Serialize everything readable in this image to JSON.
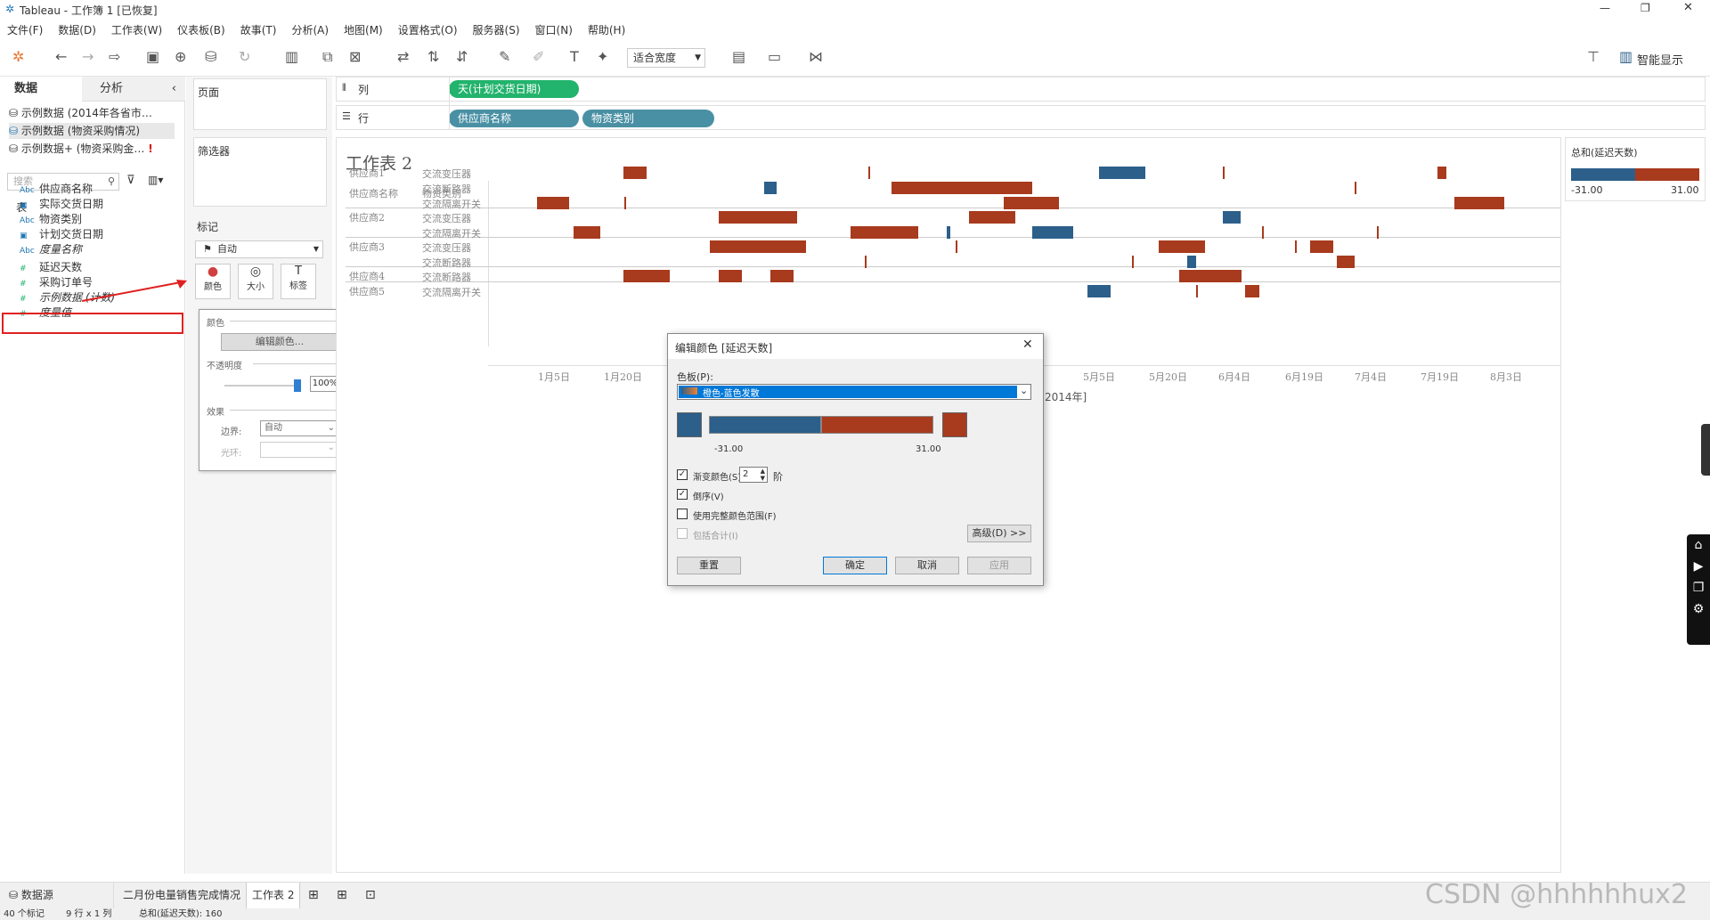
{
  "window": {
    "title": "Tableau - 工作簿 1 [已恢复]"
  },
  "menu": [
    "文件(F)",
    "数据(D)",
    "工作表(W)",
    "仪表板(B)",
    "故事(T)",
    "分析(A)",
    "地图(M)",
    "设置格式(O)",
    "服务器(S)",
    "窗口(N)",
    "帮助(H)"
  ],
  "toolbar": {
    "fit": "适合宽度",
    "smart": "智能显示"
  },
  "left": {
    "tabs": {
      "data": "数据",
      "analysis": "分析"
    },
    "sources": [
      "示例数据 (2014年各省市…",
      "示例数据 (物资采购情况)",
      "示例数据+ (物资采购金…"
    ],
    "search_placeholder": "搜索",
    "section": "表",
    "fields": [
      {
        "icon": "Abc",
        "name": "供应商名称"
      },
      {
        "icon": "▣",
        "name": "实际交货日期"
      },
      {
        "icon": "Abc",
        "name": "物资类别"
      },
      {
        "icon": "▣",
        "name": "计划交货日期"
      },
      {
        "icon": "Abc",
        "name": "度量名称"
      },
      {
        "icon": "#",
        "name": "延迟天数"
      },
      {
        "icon": "#",
        "name": "采购订单号"
      },
      {
        "icon": "#",
        "name": "示例数据 (计数)"
      },
      {
        "icon": "#",
        "name": "度量值"
      }
    ]
  },
  "cards": {
    "pages": "页面",
    "filters": "筛选器",
    "marks": "标记",
    "mark_type": "自动",
    "buttons": [
      "颜色",
      "大小",
      "标签"
    ]
  },
  "colorpop": {
    "title": "颜色",
    "edit": "编辑颜色...",
    "opacity_label": "不透明度",
    "opacity": "100%",
    "effects": "效果",
    "border_label": "边界:",
    "border_value": "自动",
    "halo_label": "光环:"
  },
  "shelves": {
    "columns_label": "列",
    "rows_label": "行",
    "columns": [
      "天(计划交货日期)"
    ],
    "rows": [
      "供应商名称",
      "物资类别"
    ]
  },
  "view": {
    "title": "工作表 2",
    "header": [
      "供应商名称",
      "物资类别"
    ],
    "suppliers": [
      "供应商1",
      "供应商2",
      "供应商3",
      "供应商4",
      "供应商5"
    ],
    "rows": [
      {
        "sup": "供应商1",
        "cat": "交流变压器"
      },
      {
        "sup": "",
        "cat": "交流断路器"
      },
      {
        "sup": "",
        "cat": "交流隔离开关"
      },
      {
        "sup": "供应商2",
        "cat": "交流变压器"
      },
      {
        "sup": "",
        "cat": "交流隔离开关"
      },
      {
        "sup": "供应商3",
        "cat": "交流变压器"
      },
      {
        "sup": "",
        "cat": "交流断路器"
      },
      {
        "sup": "供应商4",
        "cat": "交流断路器"
      },
      {
        "sup": "供应商5",
        "cat": "交流隔离开关"
      }
    ],
    "xticks": [
      "1月5日",
      "1月20日",
      "",
      "",
      "",
      "",
      "",
      "",
      "",
      "5月5日",
      "5月20日",
      "6月4日",
      "6月19日",
      "7月4日",
      "7月19日",
      "8月3日"
    ],
    "xlabel_suffix": "2014年]"
  },
  "legend": {
    "title": "总和(延迟天数)",
    "min": "-31.00",
    "max": "31.00",
    "colors": [
      "#2c5f8a",
      "#a83a1e"
    ]
  },
  "dialog": {
    "title": "编辑颜色 [延迟天数]",
    "palette_label": "色板(P):",
    "palette_value": "橙色-蓝色发散",
    "min": "-31.00",
    "max": "31.00",
    "stepped": "渐变颜色(S)",
    "steps": "2",
    "steps_unit": "阶",
    "reversed": "倒序(V)",
    "full_range": "使用完整颜色范围(F)",
    "include_totals": "包括合计(I)",
    "advanced": "高级(D) >>",
    "reset": "重置",
    "ok": "确定",
    "cancel": "取消",
    "apply": "应用"
  },
  "bottom": {
    "datasource": "数据源",
    "tabs": [
      "二月份电量销售完成情况",
      "工作表 2"
    ]
  },
  "status": {
    "marks": "40 个标记",
    "rowscols": "9 行 x 1 列",
    "sum": "总和(延迟天数): 160"
  },
  "watermark": "CSDN @hhhhhhux2"
}
